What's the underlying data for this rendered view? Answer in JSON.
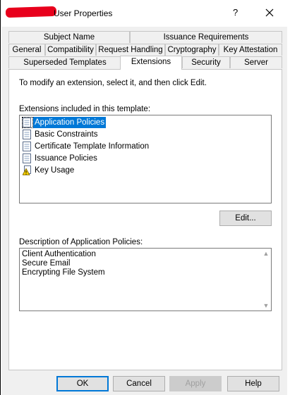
{
  "window": {
    "title": "User Properties",
    "help_label": "?",
    "close_label": "✕"
  },
  "tabs": {
    "row1": [
      "Subject Name",
      "Issuance Requirements"
    ],
    "row2": [
      "General",
      "Compatibility",
      "Request Handling",
      "Cryptography",
      "Key Attestation"
    ],
    "row3": [
      "Superseded Templates",
      "Extensions",
      "Security",
      "Server"
    ],
    "active": "Extensions"
  },
  "panel": {
    "instruction": "To modify an extension, select it, and then click Edit.",
    "extensions_label": "Extensions included in this template:",
    "extensions": [
      {
        "label": "Application Policies",
        "icon": "document-icon",
        "selected": true
      },
      {
        "label": "Basic Constraints",
        "icon": "document-icon",
        "selected": false
      },
      {
        "label": "Certificate Template Information",
        "icon": "document-icon",
        "selected": false
      },
      {
        "label": "Issuance Policies",
        "icon": "document-icon",
        "selected": false
      },
      {
        "label": "Key Usage",
        "icon": "warning-document-icon",
        "selected": false
      }
    ],
    "edit_button": "Edit...",
    "description_label": "Description of Application Policies:",
    "description_lines": [
      "Client Authentication",
      "Secure Email",
      "Encrypting File System"
    ]
  },
  "footer": {
    "ok": "OK",
    "cancel": "Cancel",
    "apply": "Apply",
    "help": "Help"
  },
  "colors": {
    "selection": "#0078d7",
    "dialog_bg": "#f0f0f0",
    "redaction": "#e8001c"
  }
}
